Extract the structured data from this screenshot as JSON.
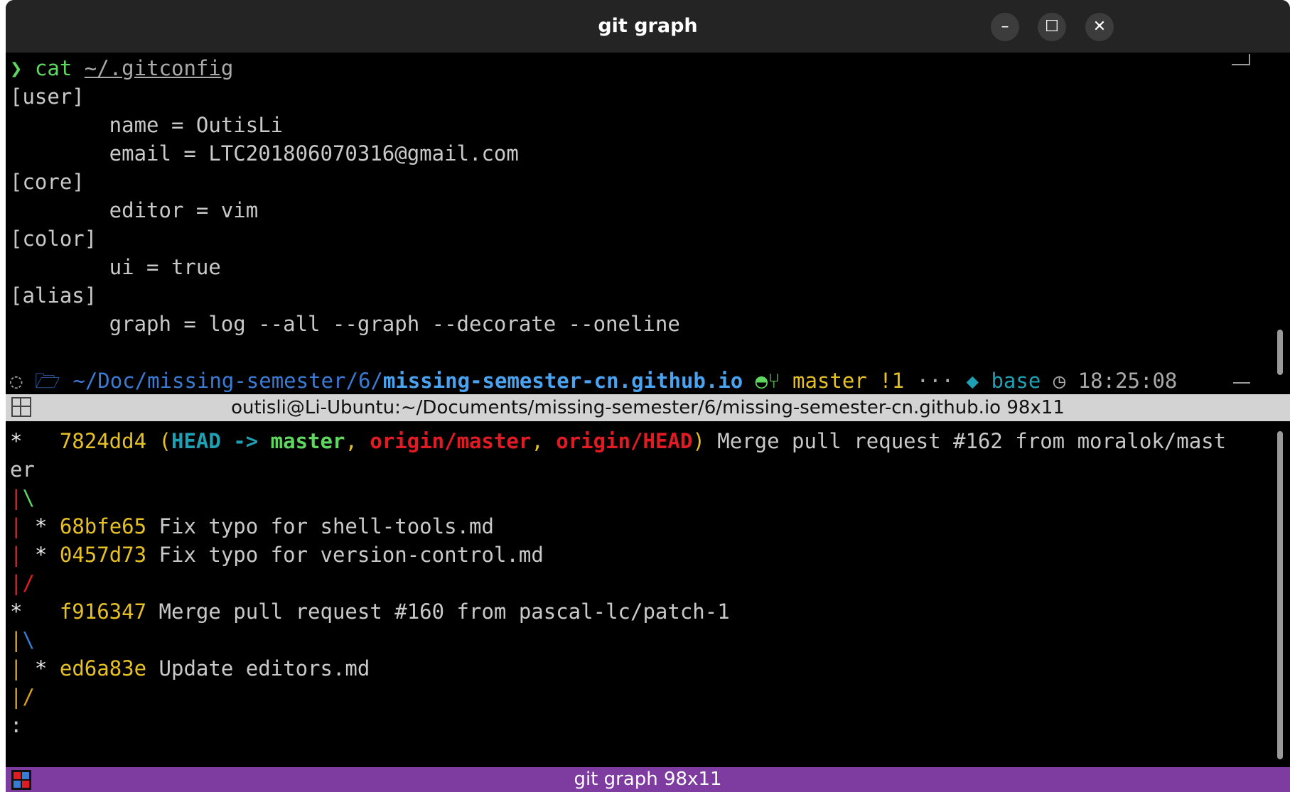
{
  "window": {
    "title": "git graph"
  },
  "top_pane": {
    "command_prompt": "❯",
    "command_word": "cat",
    "command_arg": "~/.gitconfig",
    "lines": [
      "[user]",
      "        name = OutisLi",
      "        email = LTC201806070316@gmail.com",
      "[core]",
      "        editor = vim",
      "[color]",
      "        ui = true",
      "[alias]",
      "        graph = log --all --graph --decorate --oneline"
    ],
    "prompt": {
      "folder_icon": "🗁",
      "path_prefix": "~/Doc/missing-semester/6/",
      "path_repo": "missing-semester-cn.github.io",
      "git_icon": "",
      "branch_icon": "",
      "branch": "master",
      "status": "!1",
      "dots": "···",
      "python_icon": "",
      "env": "base",
      "clock_icon": "◷",
      "time": "18:25:08"
    }
  },
  "pane_bar_top": {
    "label": "outisli@Li-Ubuntu:~/Documents/missing-semester/6/missing-semester-cn.github.io 98x11"
  },
  "bottom_pane": {
    "commit1": {
      "graph": "*   ",
      "hash": "7824dd4",
      "open": " (",
      "head": "HEAD -> ",
      "master": "master",
      "sep1": ", ",
      "origin_master": "origin/master",
      "sep2": ", ",
      "origin_head": "origin/HEAD",
      "close": ")",
      "message": " Merge pull request #162 from moralok/mast",
      "wrap": "er"
    },
    "g1": {
      "a": "|",
      "b": "\\"
    },
    "commit2": {
      "pipe": "|",
      "star": " * ",
      "hash": "68bfe65",
      "message": " Fix typo for shell-tools.md"
    },
    "commit3": {
      "pipe": "|",
      "star": " * ",
      "hash": "0457d73",
      "message": " Fix typo for version-control.md"
    },
    "g2": {
      "a": "|",
      "b": "/"
    },
    "commit4": {
      "graph": "*   ",
      "hash": "f916347",
      "message": " Merge pull request #160 from pascal-lc/patch-1"
    },
    "g3": {
      "a": "|",
      "b": "\\"
    },
    "commit5": {
      "pipe": "|",
      "star": " * ",
      "hash": "ed6a83e",
      "message": " Update editors.md"
    },
    "g4": {
      "a": "|",
      "b": "/"
    },
    "pager": ":"
  },
  "pane_bar_bottom": {
    "label": "git graph 98x11"
  },
  "colors": {
    "prompt_green": "#5fd75f",
    "path_blue": "#3a7bd5",
    "hash_yellow": "#e5c125",
    "ref_cyan": "#1ea1b4",
    "ref_red": "#e01b24",
    "statusbar_purple": "#7e3ba0"
  }
}
